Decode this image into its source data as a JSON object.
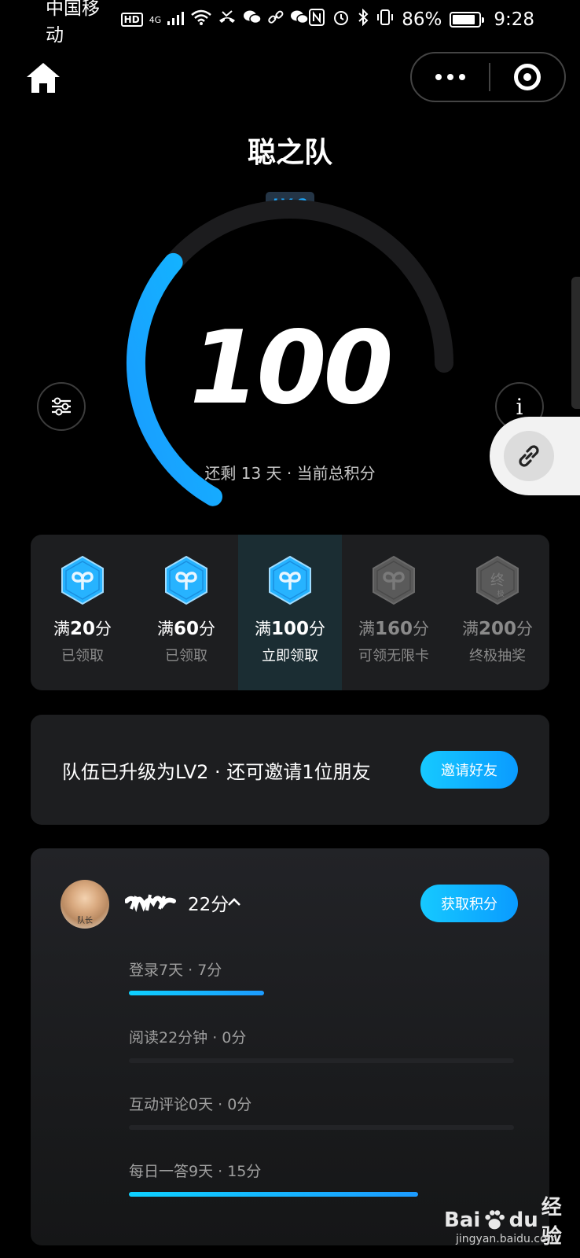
{
  "status_bar": {
    "carrier": "中国移动",
    "hd": "HD",
    "network": "4G",
    "battery_percent_text": "86%",
    "battery_level": 0.86,
    "time": "9:28"
  },
  "header": {
    "team_name": "聪之队",
    "level_badge": "LV.2"
  },
  "score": {
    "value": "100",
    "subtitle": "还剩 13 天 · 当前总积分",
    "progress": 0.42,
    "accent": "#1aa3ff"
  },
  "rewards": [
    {
      "prefix": "满",
      "points": "20",
      "unit": "分",
      "status": "已领取",
      "state": "claimed",
      "icon": "infinity-hex-icon"
    },
    {
      "prefix": "满",
      "points": "60",
      "unit": "分",
      "status": "已领取",
      "state": "claimed",
      "icon": "infinity-hex-icon"
    },
    {
      "prefix": "满",
      "points": "100",
      "unit": "分",
      "status": "立即领取",
      "state": "active",
      "icon": "infinity-hex-icon"
    },
    {
      "prefix": "满",
      "points": "160",
      "unit": "分",
      "status": "可领无限卡",
      "state": "locked",
      "icon": "infinity-hex-icon"
    },
    {
      "prefix": "满",
      "points": "200",
      "unit": "分",
      "status": "终极抽奖",
      "state": "locked",
      "icon": "final-hex-icon"
    }
  ],
  "invite": {
    "text": "队伍已升级为LV2 · 还可邀请1位朋友",
    "button": "邀请好友"
  },
  "member": {
    "avatar_tag": "队长",
    "name_points": "22分",
    "button": "获取积分",
    "tasks": [
      {
        "label": "登录7天 · 7分",
        "progress": 0.35
      },
      {
        "label": "阅读22分钟 · 0分",
        "progress": 0
      },
      {
        "label": "互动评论0天 · 0分",
        "progress": 0
      },
      {
        "label": "每日一答9天 · 15分",
        "progress": 0.75
      }
    ]
  },
  "watermark": {
    "brand": "Bai",
    "brand2": "du",
    "suffix": "经验",
    "url": "jingyan.baidu.com"
  }
}
